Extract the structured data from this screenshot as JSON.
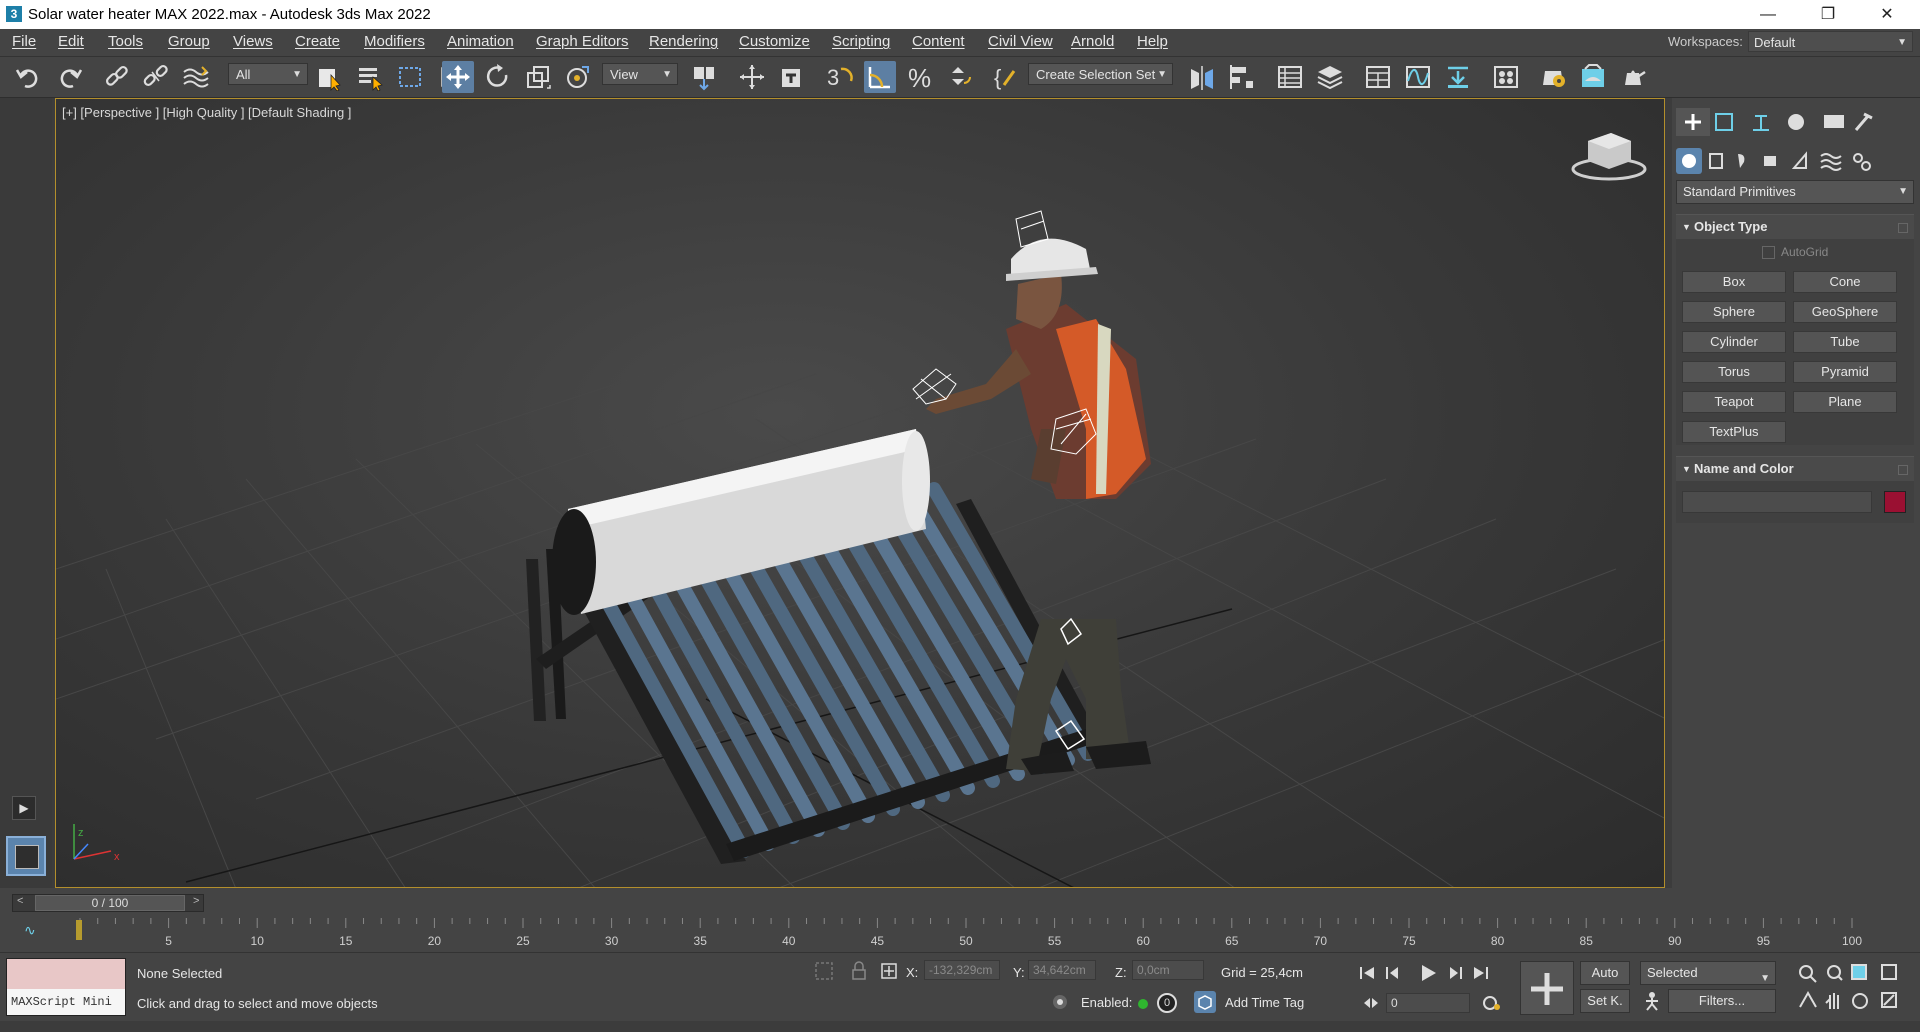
{
  "window": {
    "title": "Solar water heater MAX 2022.max - Autodesk 3ds Max 2022",
    "app_icon": "3",
    "minimize": "—",
    "maximize": "❐",
    "close": "✕"
  },
  "menu": {
    "items": [
      "File",
      "Edit",
      "Tools",
      "Group",
      "Views",
      "Create",
      "Modifiers",
      "Animation",
      "Graph Editors",
      "Rendering",
      "Customize",
      "Scripting",
      "Content",
      "Civil View",
      "Arnold",
      "Help"
    ],
    "workspaces_label": "Workspaces:",
    "workspace_value": "Default"
  },
  "toolbar": {
    "filter_value": "All",
    "refcoord_value": "View",
    "selection_set_value": "Create Selection Set",
    "snap_value": "3"
  },
  "viewport": {
    "label": "[+] [Perspective ] [High Quality ] [Default Shading ]",
    "axis_x": "x",
    "axis_z": "z"
  },
  "command_panel": {
    "category": "Standard Primitives",
    "object_type_title": "Object Type",
    "autogrid_label": "AutoGrid",
    "buttons": [
      "Box",
      "Cone",
      "Sphere",
      "GeoSphere",
      "Cylinder",
      "Tube",
      "Torus",
      "Pyramid",
      "Teapot",
      "Plane",
      "TextPlus"
    ],
    "name_color_title": "Name and Color",
    "object_color": "#9a1032"
  },
  "timeline": {
    "frame_display": "0 / 100",
    "prev": "<",
    "next": ">",
    "ticks": [
      "5",
      "10",
      "15",
      "20",
      "25",
      "30",
      "35",
      "40",
      "45",
      "50",
      "55",
      "60",
      "65",
      "70",
      "75",
      "80",
      "85",
      "90",
      "95",
      "100"
    ]
  },
  "status": {
    "maxscript_label": "MAXScript Mini",
    "selection_status": "None Selected",
    "prompt": "Click and drag to select and move objects",
    "x_label": "X:",
    "x_value": "-132,329cm",
    "y_label": "Y:",
    "y_value": "34,642cm",
    "z_label": "Z:",
    "z_value": "0,0cm",
    "grid": "Grid = 25,4cm",
    "enabled_label": "Enabled:",
    "enabled_value": "0",
    "add_time_tag": "Add Time Tag",
    "auto_key": "Auto",
    "set_key": "Set K.",
    "key_filter_value": "Selected",
    "filters": "Filters...",
    "frame_input": "0"
  }
}
